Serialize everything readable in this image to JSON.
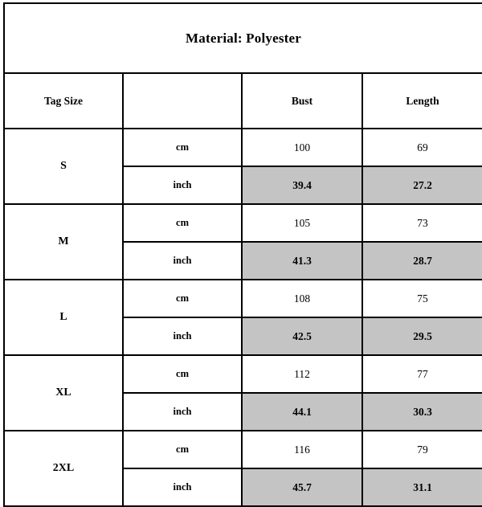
{
  "title": "Material: Polyester",
  "headers": {
    "tag_size": "Tag Size",
    "unit": "",
    "bust": "Bust",
    "length": "Length"
  },
  "units": {
    "cm": "cm",
    "inch": "inch"
  },
  "colors": {
    "shaded_cell": "#c4c4c4",
    "border": "#000000",
    "background": "#ffffff",
    "text": "#000000"
  },
  "chart_data": {
    "type": "table",
    "title": "Material: Polyester",
    "columns": [
      "Tag Size",
      "",
      "Bust",
      "Length"
    ],
    "rows": [
      {
        "size": "S",
        "unit": "cm",
        "bust": "100",
        "length": "69"
      },
      {
        "size": "S",
        "unit": "inch",
        "bust": "39.4",
        "length": "27.2"
      },
      {
        "size": "M",
        "unit": "cm",
        "bust": "105",
        "length": "73"
      },
      {
        "size": "M",
        "unit": "inch",
        "bust": "41.3",
        "length": "28.7"
      },
      {
        "size": "L",
        "unit": "cm",
        "bust": "108",
        "length": "75"
      },
      {
        "size": "L",
        "unit": "inch",
        "bust": "42.5",
        "length": "29.5"
      },
      {
        "size": "XL",
        "unit": "cm",
        "bust": "112",
        "length": "77"
      },
      {
        "size": "XL",
        "unit": "inch",
        "bust": "44.1",
        "length": "30.3"
      },
      {
        "size": "2XL",
        "unit": "cm",
        "bust": "116",
        "length": "79"
      },
      {
        "size": "2XL",
        "unit": "inch",
        "bust": "45.7",
        "length": "31.1"
      }
    ]
  },
  "sizes": [
    {
      "label": "S",
      "cm": {
        "unit": "cm",
        "bust": "100",
        "length": "69"
      },
      "inch": {
        "unit": "inch",
        "bust": "39.4",
        "length": "27.2"
      }
    },
    {
      "label": "M",
      "cm": {
        "unit": "cm",
        "bust": "105",
        "length": "73"
      },
      "inch": {
        "unit": "inch",
        "bust": "41.3",
        "length": "28.7"
      }
    },
    {
      "label": "L",
      "cm": {
        "unit": "cm",
        "bust": "108",
        "length": "75"
      },
      "inch": {
        "unit": "inch",
        "bust": "42.5",
        "length": "29.5"
      }
    },
    {
      "label": "XL",
      "cm": {
        "unit": "cm",
        "bust": "112",
        "length": "77"
      },
      "inch": {
        "unit": "inch",
        "bust": "44.1",
        "length": "30.3"
      }
    },
    {
      "label": "2XL",
      "cm": {
        "unit": "cm",
        "bust": "116",
        "length": "79"
      },
      "inch": {
        "unit": "inch",
        "bust": "45.7",
        "length": "31.1"
      }
    }
  ]
}
